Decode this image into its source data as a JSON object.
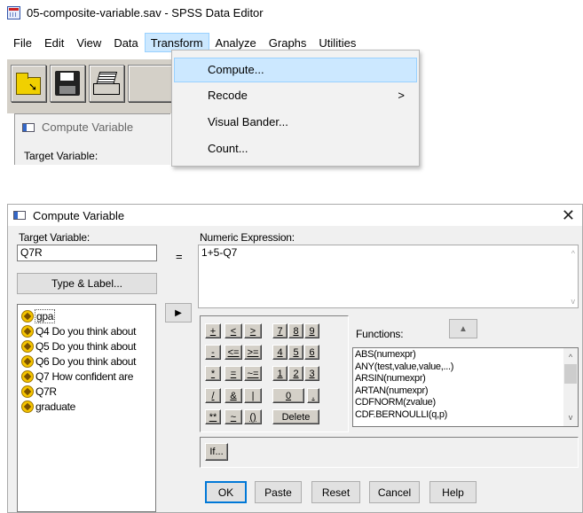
{
  "app": {
    "title": "05-composite-variable.sav - SPSS Data Editor"
  },
  "menubar": {
    "items": [
      "File",
      "Edit",
      "View",
      "Data",
      "Transform",
      "Analyze",
      "Graphs",
      "Utilities"
    ],
    "active": "Transform"
  },
  "transform_menu": {
    "items": [
      {
        "label": "Compute...",
        "highlighted": true
      },
      {
        "label": "Recode",
        "submenu_arrow": ">"
      },
      {
        "label": "Visual Bander..."
      },
      {
        "label": "Count..."
      }
    ]
  },
  "mini_dialog": {
    "title": "Compute Variable",
    "target_label": "Target Variable:"
  },
  "dialog": {
    "title": "Compute Variable",
    "target_variable": {
      "label": "Target Variable:",
      "value": "Q7R"
    },
    "equals_sign": "=",
    "numeric_expression": {
      "label": "Numeric Expression:",
      "value": "1+5-Q7"
    },
    "type_label_button": "Type & Label...",
    "move_button_glyph": "▶",
    "variables": [
      "gpa",
      "Q4 Do you think about",
      "Q5 Do you think about",
      "Q6 Do you think about",
      "Q7 How confident are",
      "Q7R",
      "graduate"
    ],
    "selected_variable": "gpa",
    "keypad": {
      "row1": [
        "+",
        "<",
        ">",
        "7",
        "8",
        "9"
      ],
      "row2": [
        "-",
        "<=",
        ">=",
        "4",
        "5",
        "6"
      ],
      "row3": [
        "*",
        "=",
        "~=",
        "1",
        "2",
        "3"
      ],
      "row4": [
        "/",
        "&",
        "|",
        "0",
        "."
      ],
      "row5": [
        "**",
        "~",
        "()",
        "Delete"
      ]
    },
    "functions": {
      "label": "Functions:",
      "up_button_glyph": "▲",
      "items": [
        "ABS(numexpr)",
        "ANY(test,value,value,...)",
        "ARSIN(numexpr)",
        "ARTAN(numexpr)",
        "CDFNORM(zvalue)",
        "CDF.BERNOULLI(q,p)"
      ]
    },
    "if_button": "If...",
    "buttons": {
      "ok": "OK",
      "paste": "Paste",
      "reset": "Reset",
      "cancel": "Cancel",
      "help": "Help"
    },
    "close_glyph": "✕"
  }
}
